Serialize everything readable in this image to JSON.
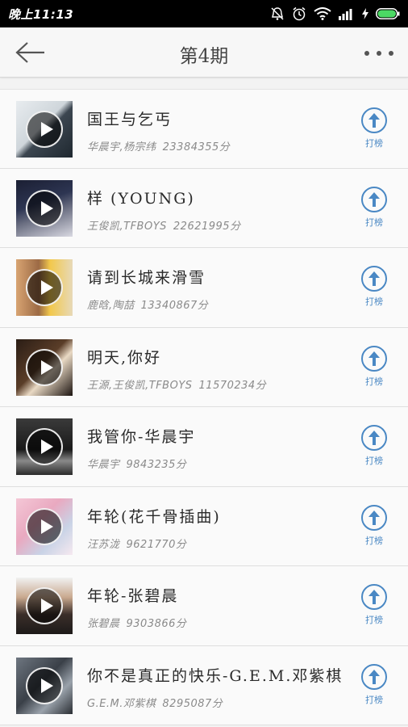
{
  "status_bar": {
    "time": "晚上11:13"
  },
  "header": {
    "title": "第4期"
  },
  "songs": [
    {
      "title": "国王与乞丐",
      "artist": "华晨宇,杨宗纬",
      "score": "23384355分",
      "vote_label": "打榜"
    },
    {
      "title": "样 (YOUNG)",
      "artist": "王俊凯,TFBOYS",
      "score": "22621995分",
      "vote_label": "打榜"
    },
    {
      "title": "请到长城来滑雪",
      "artist": "鹿晗,陶喆",
      "score": "13340867分",
      "vote_label": "打榜"
    },
    {
      "title": "明天,你好",
      "artist": "王源,王俊凯,TFBOYS",
      "score": "11570234分",
      "vote_label": "打榜"
    },
    {
      "title": "我管你-华晨宇",
      "artist": "华晨宇",
      "score": "9843235分",
      "vote_label": "打榜"
    },
    {
      "title": "年轮(花千骨插曲)",
      "artist": "汪苏泷",
      "score": "9621770分",
      "vote_label": "打榜"
    },
    {
      "title": "年轮-张碧晨",
      "artist": "张碧晨",
      "score": "9303866分",
      "vote_label": "打榜"
    },
    {
      "title": "你不是真正的快乐-G.E.M.邓紫棋",
      "artist": "G.E.M.邓紫棋",
      "score": "8295087分",
      "vote_label": "打榜"
    }
  ],
  "colors": {
    "accent": "#4a88c4",
    "status_bar": "#000000",
    "header_bg": "#f7f7f7"
  },
  "icons": {
    "back": "arrow-left-icon",
    "more": "more-dots-icon",
    "vote": "arrow-up-circle-icon",
    "play": "play-icon"
  }
}
